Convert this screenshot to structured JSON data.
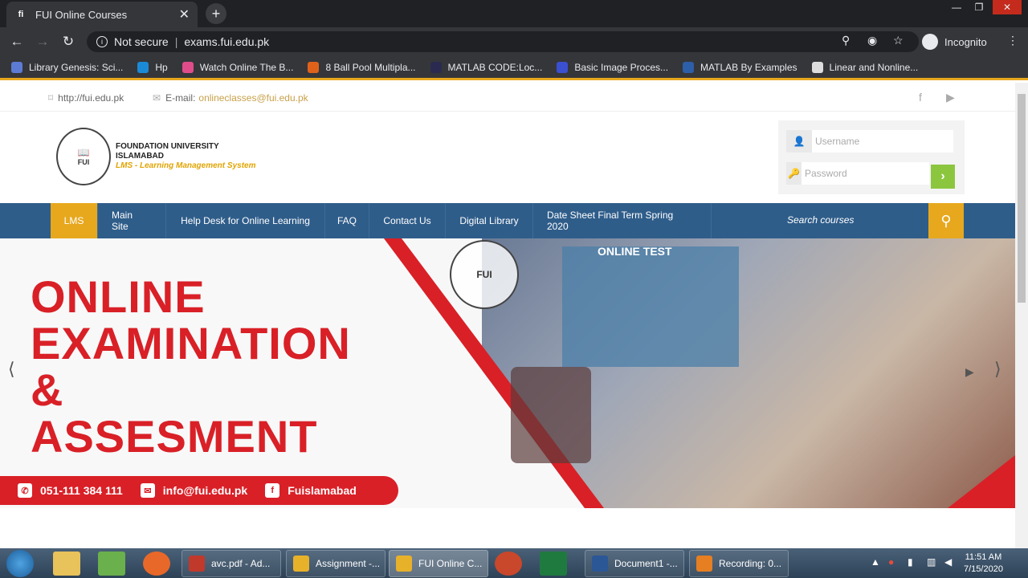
{
  "browser": {
    "tab_title": "FUI Online Courses",
    "tab_close": "✕",
    "new_tab": "+",
    "security_label": "Not secure",
    "url": "exams.fui.edu.pk",
    "incognito_label": "Incognito",
    "bookmarks": [
      {
        "label": "Library Genesis: Sci...",
        "color": "#5b7bd5"
      },
      {
        "label": "Hp",
        "color": "#1b8ad6"
      },
      {
        "label": "Watch Online The B...",
        "color": "#e04c8a"
      },
      {
        "label": "8 Ball Pool Multipla...",
        "color": "#e0621a"
      },
      {
        "label": "MATLAB CODE:Loc...",
        "color": "#2a2a50"
      },
      {
        "label": "Basic Image Proces...",
        "color": "#3b4fd1"
      },
      {
        "label": "MATLAB By Examples",
        "color": "#2d5ea8"
      },
      {
        "label": "Linear and Nonline...",
        "color": "#dddddd"
      }
    ]
  },
  "site": {
    "top_link": "http://fui.edu.pk",
    "email_prefix": "E-mail:",
    "email": "onlineclasses@fui.edu.pk",
    "logo_line1": "FOUNDATION UNIVERSITY",
    "logo_line2": "ISLAMABAD",
    "logo_line3": "LMS - Learning Management System",
    "logo_seal_text": "FUI",
    "username_placeholder": "Username",
    "password_placeholder": "Password",
    "nav": [
      "LMS",
      "Main Site",
      "Help Desk for Online Learning",
      "FAQ",
      "Contact Us",
      "Digital Library",
      "Date Sheet Final Term Spring 2020"
    ],
    "search_placeholder": "Search courses",
    "banner": {
      "line1": "ONLINE",
      "line2": "EXAMINATION",
      "line3": "&",
      "line4": "ASSESMENT",
      "phone": "051-111 384 111",
      "email": "info@fui.edu.pk",
      "facebook": "Fuislamabad",
      "seal_text": "FUI",
      "screen_text": "ONLINE TEST"
    }
  },
  "taskbar": {
    "buttons": [
      {
        "label": "avc.pdf - Ad...",
        "color": "#c0392b"
      },
      {
        "label": "Assignment -...",
        "color": "#e8b12a"
      },
      {
        "label": "FUI Online C...",
        "color": "#e8b12a"
      },
      {
        "label": "Document1 -...",
        "color": "#2b5797"
      },
      {
        "label": "Recording: 0...",
        "color": "#e67e22"
      }
    ],
    "time": "11:51 AM",
    "date": "7/15/2020"
  },
  "colors": {
    "brand_red": "#d92027",
    "nav_blue": "#2f5d8a",
    "accent_gold": "#e7a81e",
    "login_green": "#8cc63f"
  }
}
